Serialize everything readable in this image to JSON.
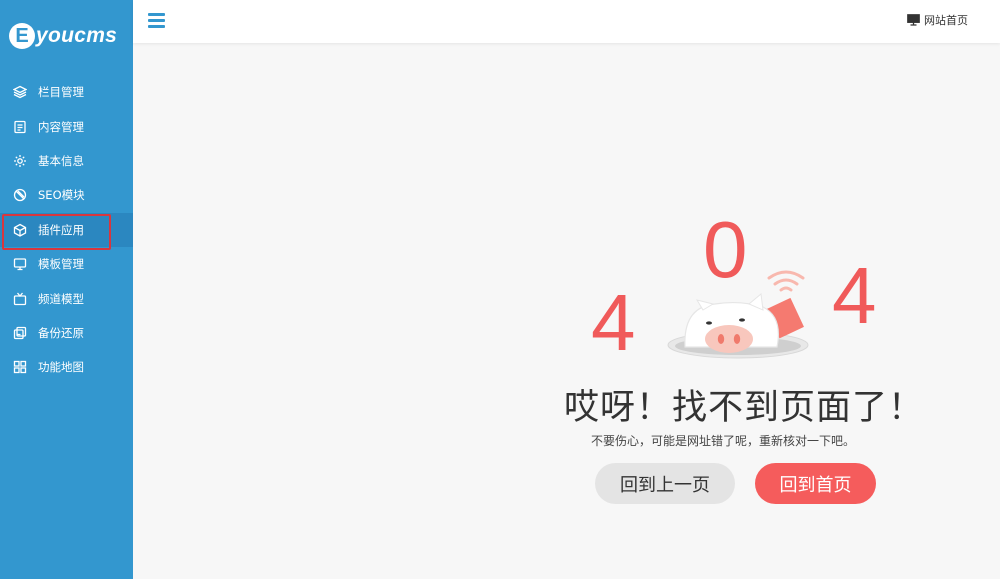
{
  "logo": {
    "mark": "E",
    "text": "youcms"
  },
  "sidebar": {
    "items": [
      {
        "label": "栏目管理",
        "icon": "layers-icon"
      },
      {
        "label": "内容管理",
        "icon": "document-icon"
      },
      {
        "label": "基本信息",
        "icon": "gear-icon"
      },
      {
        "label": "SEO模块",
        "icon": "compass-icon"
      },
      {
        "label": "插件应用",
        "icon": "cube-icon",
        "active": true
      },
      {
        "label": "模板管理",
        "icon": "monitor-icon"
      },
      {
        "label": "频道模型",
        "icon": "tv-icon"
      },
      {
        "label": "备份还原",
        "icon": "backup-icon"
      },
      {
        "label": "功能地图",
        "icon": "grid-icon"
      }
    ]
  },
  "topbar": {
    "home_link": "网站首页",
    "menu_icon": "hamburger-icon",
    "home_icon": "monitor-icon"
  },
  "error": {
    "digit1": "4",
    "digit2": "0",
    "digit3": "4",
    "headline": "哎呀！找不到页面了！",
    "message": "不要伤心，可能是网址错了呢，重新核对一下吧。",
    "back_button": "回到上一页",
    "home_button": "回到首页"
  },
  "colors": {
    "sidebar": "#3397cf",
    "accent_red": "#f05a5a",
    "highlight_border": "#d9363e"
  }
}
